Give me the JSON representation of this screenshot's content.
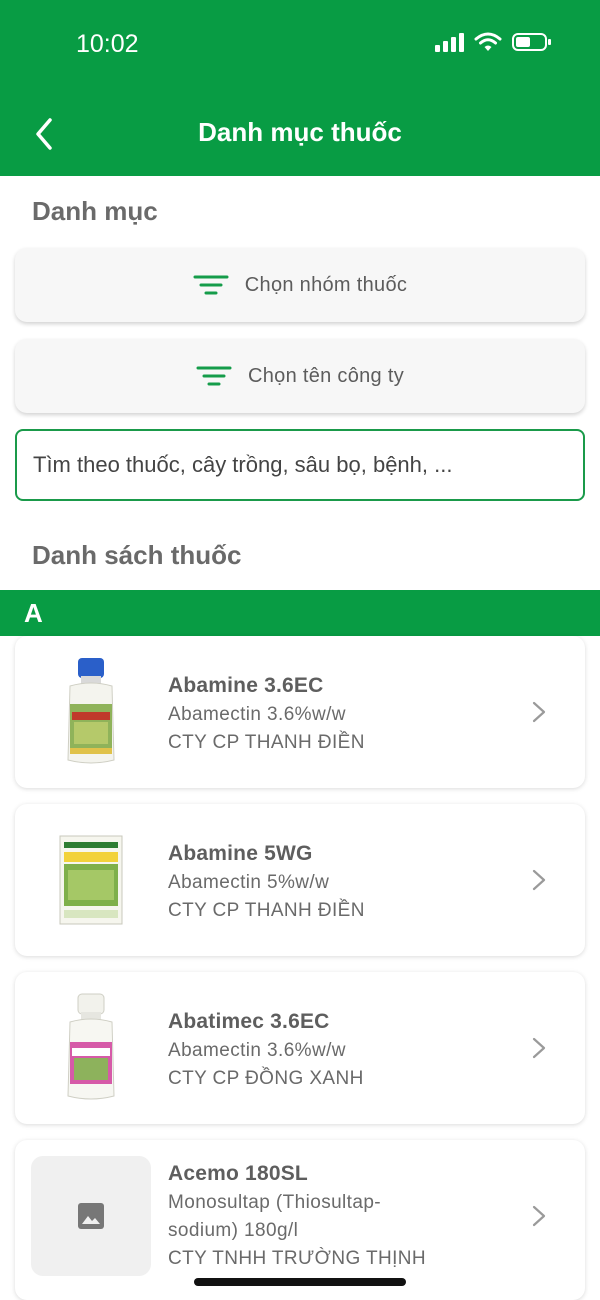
{
  "status_bar": {
    "time": "10:02"
  },
  "header": {
    "title": "Danh mục thuốc"
  },
  "category": {
    "title": "Danh mục",
    "group_button": "Chọn nhóm thuốc",
    "company_button": "Chọn tên công ty"
  },
  "search": {
    "placeholder": "Tìm theo thuốc, cây trồng, sâu bọ, bệnh, ..."
  },
  "list": {
    "title": "Danh sách thuốc",
    "section_letter": "A",
    "items": [
      {
        "name": "Abamine 3.6EC",
        "ingredient": "Abamectin 3.6%w/w",
        "company": "CTY CP THANH ĐIỀN"
      },
      {
        "name": "Abamine 5WG",
        "ingredient": "Abamectin 5%w/w",
        "company": "CTY CP THANH ĐIỀN"
      },
      {
        "name": "Abatimec 3.6EC",
        "ingredient": "Abamectin 3.6%w/w",
        "company": "CTY CP ĐỒNG XANH"
      },
      {
        "name": "Acemo 180SL",
        "ingredient_line1": "Monosultap (Thiosultap-",
        "ingredient_line2": "sodium) 180g/l",
        "company": "CTY TNHH TRƯỜNG THỊNH"
      }
    ]
  },
  "colors": {
    "brand_green": "#089c44",
    "border_green": "#1a9a4a"
  },
  "icons": [
    "back-arrow-icon",
    "signal-icon",
    "wifi-icon",
    "battery-icon",
    "filter-icon",
    "chevron-right-icon",
    "image-placeholder-icon"
  ]
}
